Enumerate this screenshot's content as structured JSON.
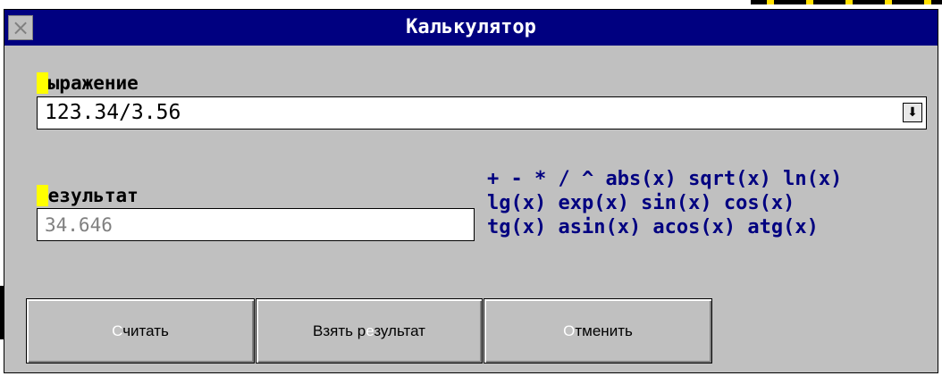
{
  "window": {
    "title": "Калькулятор"
  },
  "expression": {
    "label_mnemonic": "В",
    "label_rest": "ыражение",
    "value": "123.34/3.56"
  },
  "result": {
    "label_mnemonic": "Р",
    "label_rest": "езультат",
    "value": "34.646"
  },
  "help_lines": [
    "+ - * / ^ abs(x) sqrt(x) ln(x)",
    "lg(x) exp(x) sin(x) cos(x)",
    "tg(x) asin(x) acos(x) atg(x)"
  ],
  "buttons": {
    "calculate": {
      "mn": "С",
      "rest": "читать"
    },
    "take_result": {
      "pre": "Взять р",
      "mn": "е",
      "rest": "зультат"
    },
    "cancel": {
      "mn": "О",
      "rest": "тменить"
    }
  },
  "icons": {
    "close": "close-icon",
    "dropdown": "dropdown-arrow-icon"
  },
  "colors": {
    "titlebar": "#000080",
    "dialog": "#c0c0c0",
    "help_text": "#000080",
    "mnemonic": "#ffff00"
  }
}
